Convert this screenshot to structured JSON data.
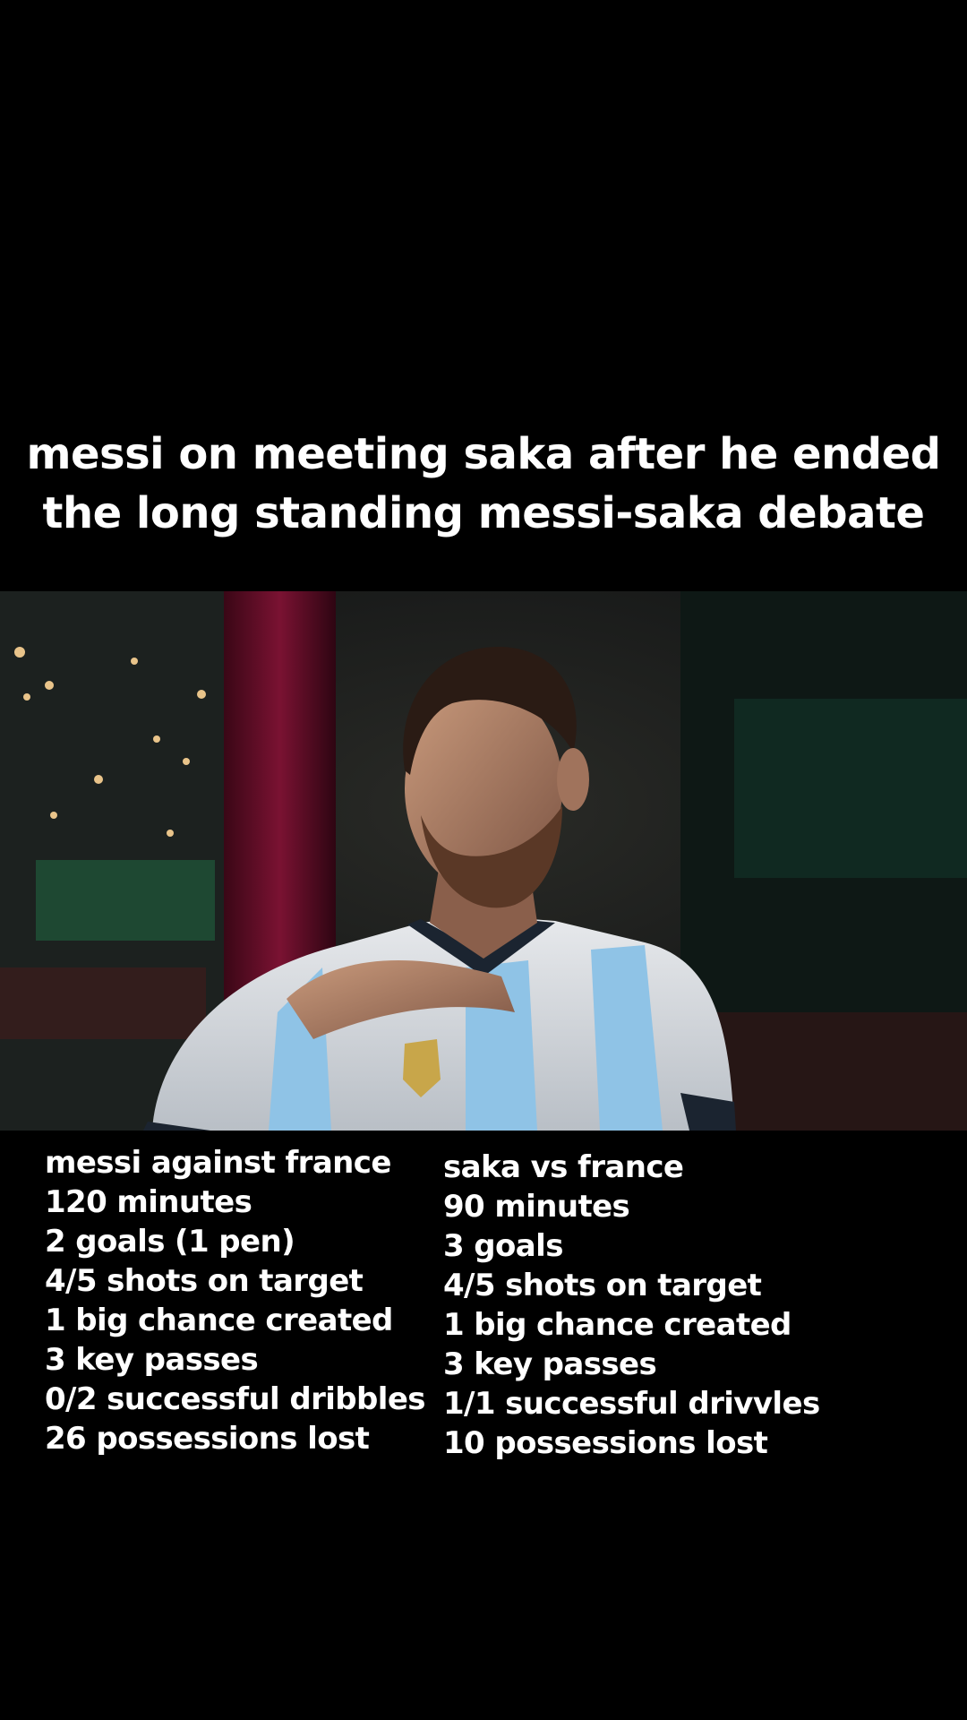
{
  "caption": {
    "line1": "messi on meeting saka after he ended",
    "line2": "the long standing messi-saka debate"
  },
  "video": {
    "subject": "man in white and light-blue striped football jersey seated in a dimly lit room with a red curtain and window lights behind",
    "colors": {
      "jersey_stripe": "#8fc3e6",
      "curtain": "#6e0f2a",
      "background": "#15181a"
    }
  },
  "stats": {
    "left": {
      "title": "messi against france",
      "lines": [
        "120 minutes",
        "2 goals (1 pen)",
        "4/5 shots on target",
        "1 big chance created",
        "3 key passes",
        "0/2 successful dribbles",
        "26 possessions lost"
      ]
    },
    "right": {
      "title": "saka vs france",
      "lines": [
        "90 minutes",
        "3 goals",
        "4/5 shots on target",
        "1 big chance created",
        "3 key passes",
        "1/1 successful drivvles",
        "10 possessions lost"
      ]
    }
  }
}
